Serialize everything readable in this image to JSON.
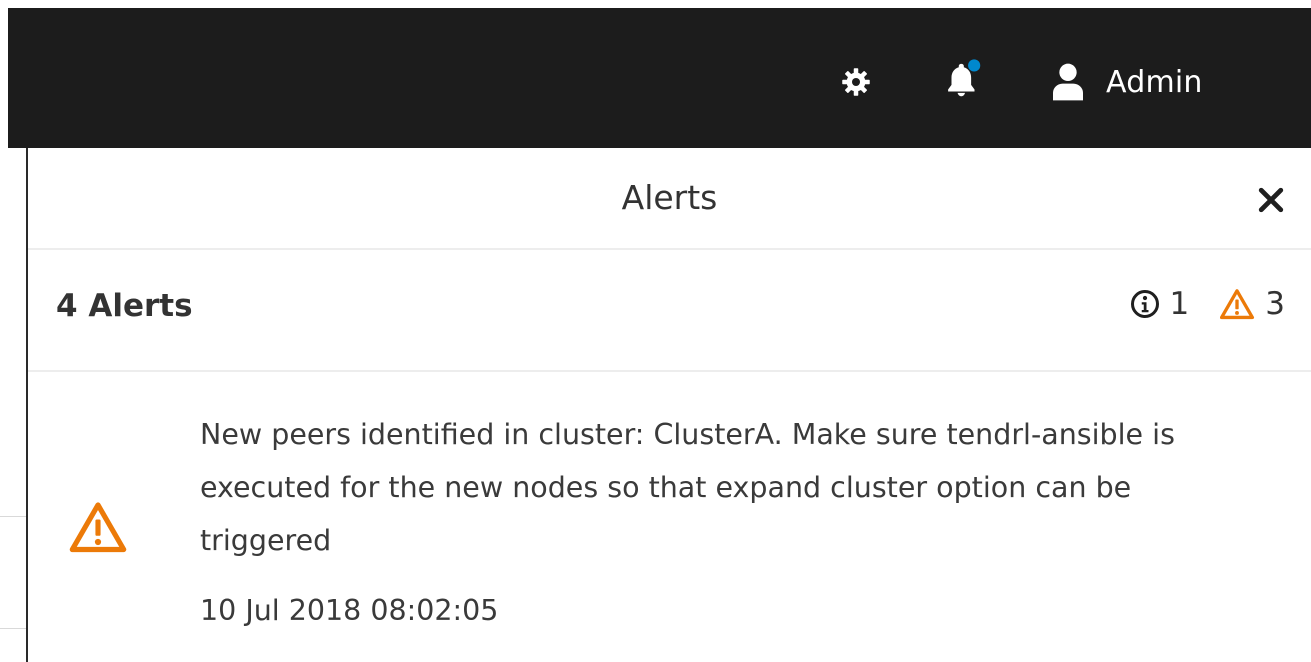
{
  "header": {
    "icons": {
      "settings": "gear-icon",
      "notifications": "bell-icon",
      "user": "user-icon"
    },
    "notification_dot_color": "#0088ce",
    "user_name": "Admin"
  },
  "alerts_drawer": {
    "title": "Alerts",
    "close_icon": "close-icon",
    "summary": {
      "title": "4 Alerts",
      "info_count": "1",
      "warning_count": "3"
    },
    "items": [
      {
        "severity": "warning",
        "severity_color": "#ec7a08",
        "message": "New peers identified in cluster: ClusterA. Make sure tendrl-ansible is executed for the new nodes so that expand cluster option can be triggered",
        "timestamp": "10 Jul 2018 08:02:05"
      }
    ]
  },
  "colors": {
    "topbar": "#1c1c1c",
    "warning": "#ec7a08",
    "text": "#333333"
  }
}
